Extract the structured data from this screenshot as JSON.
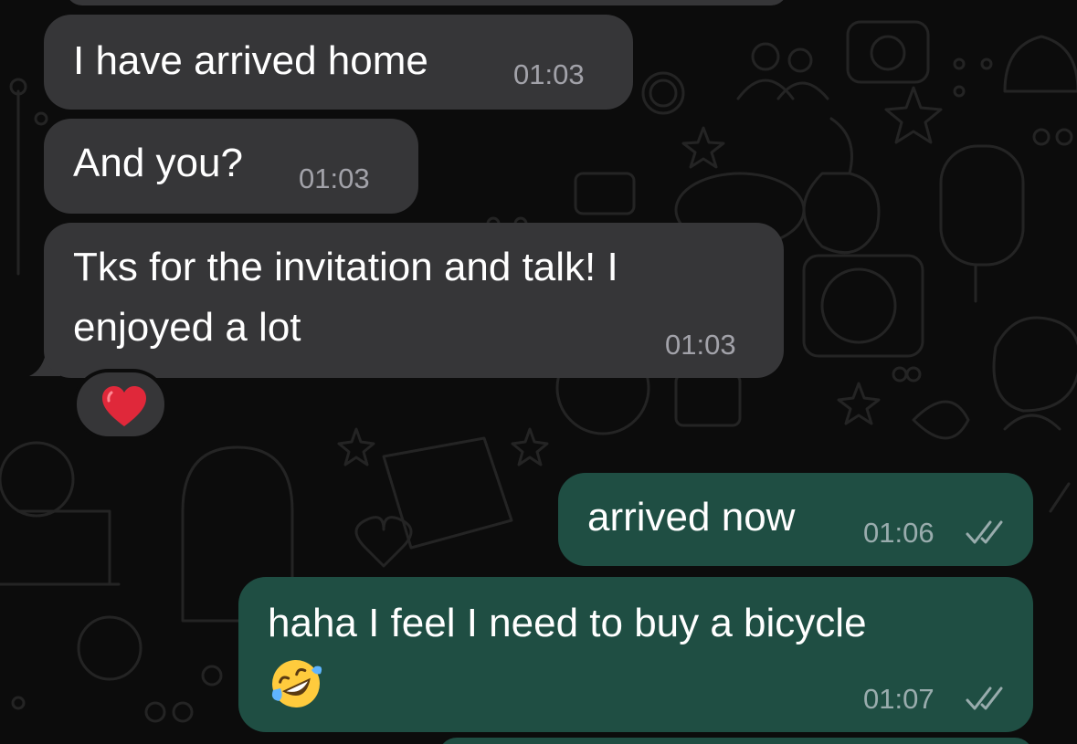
{
  "messages": [
    {
      "direction": "incoming",
      "text": "I have arrived home",
      "time": "01:03"
    },
    {
      "direction": "incoming",
      "text": "And you?",
      "time": "01:03"
    },
    {
      "direction": "incoming",
      "lines": [
        "Tks for the invitation and talk!  I",
        "enjoyed a lot"
      ],
      "time": "01:03",
      "reaction": "red-heart"
    },
    {
      "direction": "outgoing",
      "text": "arrived now",
      "time": "01:06",
      "status": "delivered-double-check"
    },
    {
      "direction": "outgoing",
      "text": "haha I feel I need to buy a bicycle",
      "emoji": "rolling-on-floor-laughing",
      "time": "01:07",
      "status": "delivered-double-check"
    }
  ],
  "colors": {
    "incoming_bubble": "#363638",
    "outgoing_bubble": "#1f4e43",
    "background": "#0c0c0c",
    "timestamp": "#9a9a9f"
  }
}
